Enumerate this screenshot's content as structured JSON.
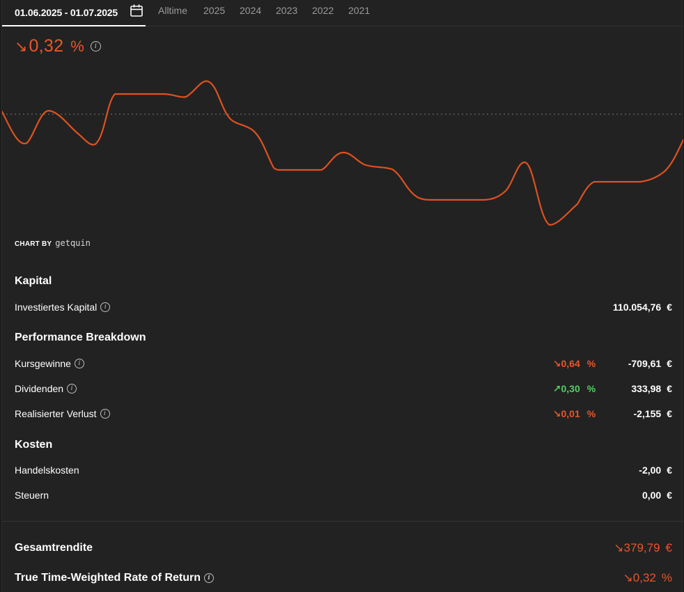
{
  "tabs": {
    "active_range": "01.06.2025 - 01.07.2025",
    "items": [
      "Alltime",
      "2025",
      "2024",
      "2023",
      "2022",
      "2021"
    ]
  },
  "headline": {
    "arrow": "↘",
    "value": "0,32",
    "unit": "%"
  },
  "chart_by": {
    "label": "CHART BY",
    "brand": "getquin"
  },
  "colors": {
    "negative": "#e8562a",
    "positive": "#4fcf62",
    "line": "#e0511f"
  },
  "kapital": {
    "title": "Kapital",
    "invested_label": "Investiertes Kapital",
    "invested_amount": "110.054,76",
    "currency": "€"
  },
  "breakdown": {
    "title": "Performance Breakdown",
    "rows": [
      {
        "label": "Kursgewinne",
        "arrow": "↘",
        "pct": "0,64",
        "pct_unit": "%",
        "amount": "-709,61",
        "currency": "€"
      },
      {
        "label": "Dividenden",
        "arrow": "↗",
        "pct": "0,30",
        "pct_unit": "%",
        "amount": "333,98",
        "currency": "€"
      },
      {
        "label": "Realisierter Verlust",
        "arrow": "↘",
        "pct": "0,01",
        "pct_unit": "%",
        "amount": "-2,155",
        "currency": "€"
      }
    ]
  },
  "kosten": {
    "title": "Kosten",
    "rows": [
      {
        "label": "Handelskosten",
        "amount": "-2,00",
        "currency": "€"
      },
      {
        "label": "Steuern",
        "amount": "0,00",
        "currency": "€"
      }
    ]
  },
  "totals": {
    "gesamt_label": "Gesamtrendite",
    "gesamt_arrow": "↘",
    "gesamt_value": "379,79",
    "gesamt_currency": "€",
    "ttwror_label": "True Time-Weighted Rate of Return",
    "ttwror_arrow": "↘",
    "ttwror_value": "0,32",
    "ttwror_unit": "%"
  }
}
